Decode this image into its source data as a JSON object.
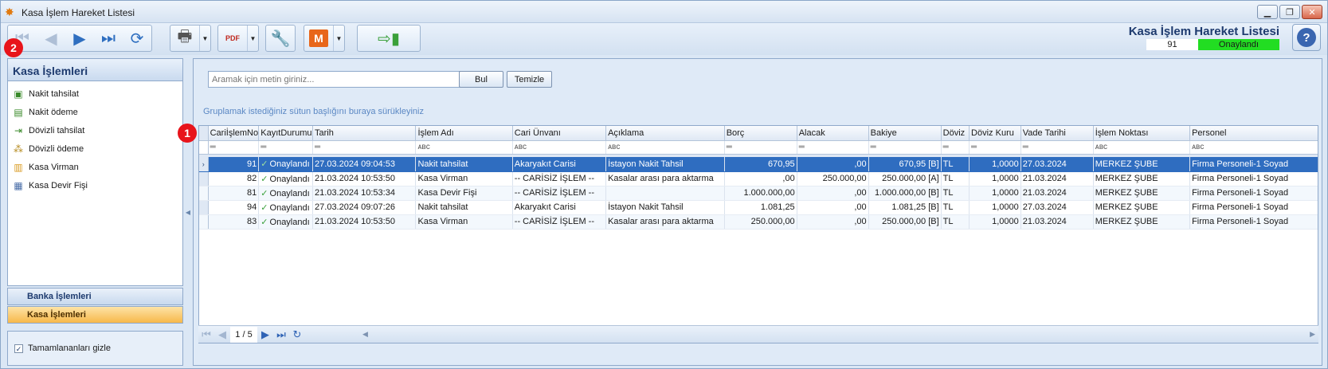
{
  "window": {
    "title": "Kasa İşlem Hareket Listesi",
    "buttons": [
      "▭",
      "◻",
      "✕"
    ]
  },
  "toolbar": {
    "brand_title": "Kasa İşlem Hareket Listesi",
    "record_no": "91",
    "record_status": "Onaylandı",
    "help": "?",
    "print_pdf_label": "PDF",
    "m_label": "M"
  },
  "badges": {
    "one": "1",
    "two": "2"
  },
  "nav": {
    "header": "Kasa İşlemleri",
    "items": [
      {
        "label": "Nakit tahsilat",
        "icon": "cash-in-icon"
      },
      {
        "label": "Nakit ödeme",
        "icon": "cash-out-icon"
      },
      {
        "label": "Dövizli tahsilat",
        "icon": "fx-in-icon"
      },
      {
        "label": "Dövizli ödeme",
        "icon": "fx-out-icon"
      },
      {
        "label": "Kasa Virman",
        "icon": "transfer-icon"
      },
      {
        "label": "Kasa Devir Fişi",
        "icon": "carryover-icon"
      }
    ],
    "bank_group": "Banka İşlemleri",
    "kasa_group": "Kasa İşlemleri",
    "hide_completed": "Tamamlananları gizle"
  },
  "search": {
    "placeholder": "Aramak için metin giriniz...",
    "find_label": "Bul",
    "clear_label": "Temizle",
    "group_hint": "Gruplamak istediğiniz sütun başlığını buraya sürükleyiniz"
  },
  "grid": {
    "columns": [
      "CariİşlemNo",
      "KayıtDurumu",
      "Tarih",
      "İşlem Adı",
      "Cari Ünvanı",
      "Açıklama",
      "Borç",
      "Alacak",
      "Bakiye",
      "Döviz",
      "Döviz Kuru",
      "Vade Tarihi",
      "İşlem Noktası",
      "Personel"
    ],
    "rows": [
      {
        "no": "91",
        "status": "Onaylandı",
        "tarih": "27.03.2024 09:04:53",
        "islem": "Nakit tahsilat",
        "cari": "Akaryakıt Carisi",
        "aciklama": "İstayon Nakit Tahsil",
        "borc": "670,95",
        "alacak": ",00",
        "bakiye": "670,95 [B]",
        "doviz": "TL",
        "kur": "1,0000",
        "vade": "27.03.2024",
        "nokta": "MERKEZ ŞUBE",
        "personel": "Firma Personeli-1 Soyad"
      },
      {
        "no": "82",
        "status": "Onaylandı",
        "tarih": "21.03.2024 10:53:50",
        "islem": "Kasa Virman",
        "cari": "-- CARİSİZ İŞLEM --",
        "aciklama": "Kasalar arası para aktarma",
        "borc": ",00",
        "alacak": "250.000,00",
        "bakiye": "250.000,00 [A]",
        "doviz": "TL",
        "kur": "1,0000",
        "vade": "21.03.2024",
        "nokta": "MERKEZ ŞUBE",
        "personel": "Firma Personeli-1 Soyad"
      },
      {
        "no": "81",
        "status": "Onaylandı",
        "tarih": "21.03.2024 10:53:34",
        "islem": "Kasa Devir Fişi",
        "cari": "-- CARİSİZ İŞLEM --",
        "aciklama": "",
        "borc": "1.000.000,00",
        "alacak": ",00",
        "bakiye": "1.000.000,00 [B]",
        "doviz": "TL",
        "kur": "1,0000",
        "vade": "21.03.2024",
        "nokta": "MERKEZ ŞUBE",
        "personel": "Firma Personeli-1 Soyad"
      },
      {
        "no": "94",
        "status": "Onaylandı",
        "tarih": "27.03.2024 09:07:26",
        "islem": "Nakit tahsilat",
        "cari": "Akaryakıt Carisi",
        "aciklama": "İstayon Nakit Tahsil",
        "borc": "1.081,25",
        "alacak": ",00",
        "bakiye": "1.081,25 [B]",
        "doviz": "TL",
        "kur": "1,0000",
        "vade": "27.03.2024",
        "nokta": "MERKEZ ŞUBE",
        "personel": "Firma Personeli-1 Soyad"
      },
      {
        "no": "83",
        "status": "Onaylandı",
        "tarih": "21.03.2024 10:53:50",
        "islem": "Kasa Virman",
        "cari": "-- CARİSİZ İŞLEM --",
        "aciklama": "Kasalar arası para aktarma",
        "borc": "250.000,00",
        "alacak": ",00",
        "bakiye": "250.000,00 [B]",
        "doviz": "TL",
        "kur": "1,0000",
        "vade": "21.03.2024",
        "nokta": "MERKEZ ŞUBE",
        "personel": "Firma Personeli-1 Soyad"
      }
    ]
  },
  "pager": {
    "page_text": "1 / 5"
  },
  "colors": {
    "selected_row": "#2f6dc0",
    "status_green": "#22dd22",
    "badge_red": "#e8141b",
    "active_group": "#f7b84a"
  }
}
